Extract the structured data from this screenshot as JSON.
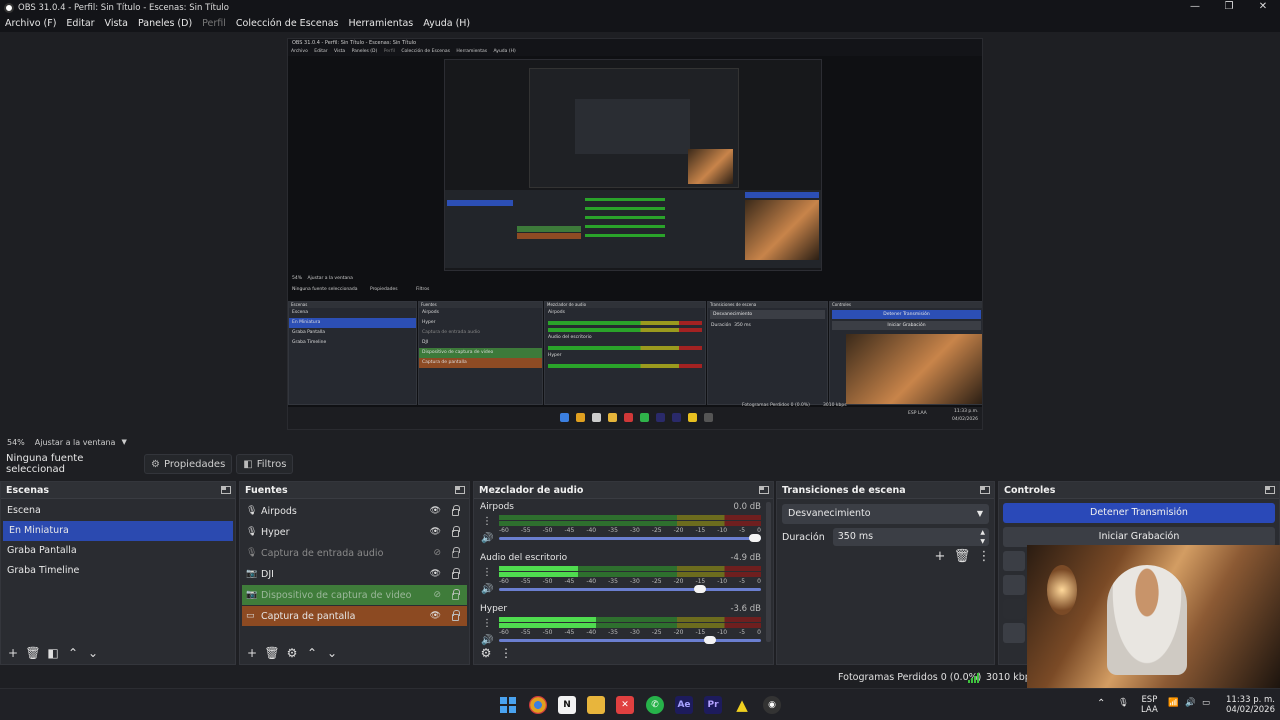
{
  "window": {
    "title": "OBS 31.0.4 - Perfil: Sin Título - Escenas: Sin Título"
  },
  "menu": [
    {
      "label": "Archivo (F)",
      "disabled": false
    },
    {
      "label": "Editar",
      "disabled": false
    },
    {
      "label": "Vista",
      "disabled": false
    },
    {
      "label": "Paneles (D)",
      "disabled": false
    },
    {
      "label": "Perfil",
      "disabled": true
    },
    {
      "label": "Colección de Escenas",
      "disabled": false
    },
    {
      "label": "Herramientas",
      "disabled": false
    },
    {
      "label": "Ayuda (H)",
      "disabled": false
    }
  ],
  "preview": {
    "zoom": "54%",
    "fit_label": "Ajustar a la ventana",
    "nested_title": "OBS 31.0.4 - Perfil: Sin Título - Escenas: Sin Título",
    "nested_menu": [
      "Archivo",
      "Editar",
      "Vista",
      "Paneles (D)",
      "Perfil",
      "Colección de Escenas",
      "Herramientas",
      "Ayuda (H)"
    ],
    "nested_no_source": "Ninguna fuente seleccionada",
    "nested_props": "Propiedades",
    "nested_filters": "Filtros",
    "nested_scenes_title": "Escenas",
    "nested_sources_title": "Fuentes",
    "nested_mixer_title": "Mezclador de audio",
    "nested_transitions_title": "Transiciones de escena",
    "nested_controls_title": "Controles",
    "nested_stop_stream": "Detener Transmisión",
    "nested_start_rec": "Iniciar Grabación",
    "nested_dropped": "Fotogramas Perdidos 0 (0.0%)",
    "nested_kbps": "3010 kbps",
    "nested_lang": "ESP LAA",
    "nested_time": "11:33 p.m.",
    "nested_date": "04/02/2026"
  },
  "source_toolbar": {
    "no_source": "Ninguna fuente seleccionad",
    "properties": "Propiedades",
    "filters": "Filtros"
  },
  "scenes": {
    "title": "Escenas",
    "items": [
      {
        "label": "Escena",
        "selected": false
      },
      {
        "label": "En Miniatura",
        "selected": true
      },
      {
        "label": "Graba Pantalla",
        "selected": false
      },
      {
        "label": "Graba Timeline",
        "selected": false
      }
    ]
  },
  "sources": {
    "title": "Fuentes",
    "items": [
      {
        "label": "Airpods",
        "icon": "microphone-icon",
        "style": "normal",
        "visible": true
      },
      {
        "label": "Hyper",
        "icon": "microphone-icon",
        "style": "normal",
        "visible": true
      },
      {
        "label": "Captura de entrada audio",
        "icon": "microphone-icon",
        "style": "dim",
        "visible": false
      },
      {
        "label": "DJI",
        "icon": "camera-icon",
        "style": "normal",
        "visible": true
      },
      {
        "label": "Dispositivo de captura de video",
        "icon": "camera-icon",
        "style": "green",
        "visible": false
      },
      {
        "label": "Captura de pantalla",
        "icon": "monitor-icon",
        "style": "orange",
        "visible": true
      }
    ]
  },
  "mixer": {
    "title": "Mezclador de audio",
    "ticks": [
      "-60",
      "-55",
      "-50",
      "-45",
      "-40",
      "-35",
      "-30",
      "-25",
      "-20",
      "-15",
      "-10",
      "-5",
      "0"
    ],
    "channels": [
      {
        "name": "Airpods",
        "db": "0.0 dB",
        "level": 0.0,
        "volume": 1.0
      },
      {
        "name": "Audio del escritorio",
        "db": "-4.9 dB",
        "level": 0.3,
        "volume": 0.79
      },
      {
        "name": "Hyper",
        "db": "-3.6 dB",
        "level": 0.37,
        "volume": 0.83
      }
    ]
  },
  "transitions": {
    "title": "Transiciones de escena",
    "selected": "Desvanecimiento",
    "duration_label": "Duración",
    "duration_value": "350 ms"
  },
  "controls": {
    "title": "Controles",
    "stop_stream": "Detener Transmisión",
    "start_recording": "Iniciar Grabación"
  },
  "status": {
    "dropped_frames": "Fotogramas Perdidos 0 (0.0%)",
    "bitrate": "3010 kbps"
  },
  "taskbar": {
    "lang_line1": "ESP",
    "lang_line2": "LAA",
    "time": "11:33 p. m.",
    "date": "04/02/2026"
  }
}
